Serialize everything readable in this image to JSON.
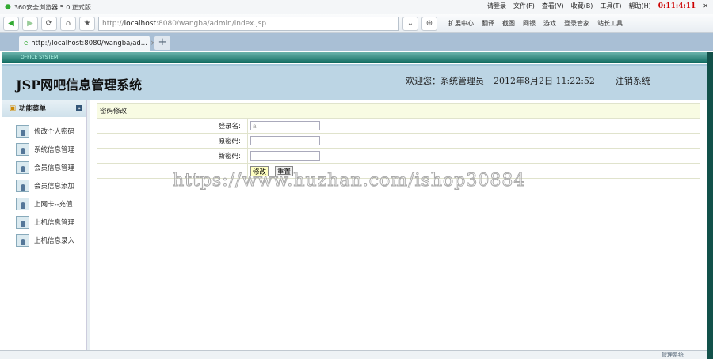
{
  "browser": {
    "title": "360安全浏览器 5.0 正式版",
    "login": "请登录",
    "menus": [
      "文件(F)",
      "查看(V)",
      "收藏(B)",
      "工具(T)",
      "帮助(H)"
    ],
    "clock": "0:11:4:11",
    "url_prefix": "http://",
    "url_host": "localhost",
    "url_rest": ":8080/wangba/admin/index.jsp",
    "tools": [
      "扩展中心",
      "翻译",
      "截图",
      "网银",
      "游戏",
      "登录管家",
      "站长工具"
    ],
    "tab_label": "http://localhost:8080/wangba/ad...",
    "status_text": "管理系统"
  },
  "banner": {
    "text": "OFFICE SYSTEM"
  },
  "header": {
    "title": "JSP网吧信息管理系统",
    "welcome": "欢迎您：系统管理员",
    "datetime": "2012年8月2日  11:22:52",
    "logout": "注销系统"
  },
  "sidebar": {
    "title": "功能菜单",
    "items": [
      {
        "label": "修改个人密码"
      },
      {
        "label": "系统信息管理"
      },
      {
        "label": "会员信息管理"
      },
      {
        "label": "会员信息添加"
      },
      {
        "label": "上网卡--充值"
      },
      {
        "label": "上机信息管理"
      },
      {
        "label": "上机信息录入"
      }
    ]
  },
  "form": {
    "title": "密码修改",
    "login_label": "登录名:",
    "login_value": "a",
    "old_label": "原密码:",
    "new_label": "新密码:",
    "submit": "修改",
    "reset": "重置"
  },
  "watermark": "https://www.huzhan.com/ishop30884"
}
